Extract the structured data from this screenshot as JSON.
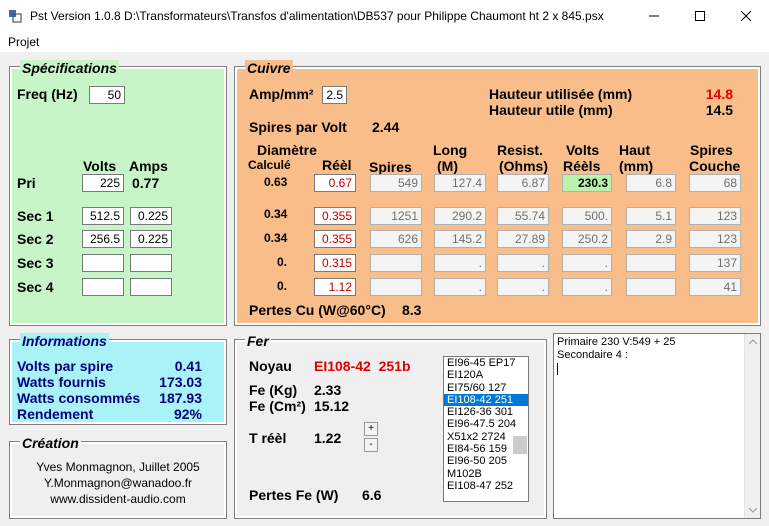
{
  "window": {
    "title": "Pst Version 1.0.8   D:\\Transformateurs\\Transfos d'alimentation\\DB537 pour Philippe Chaumont  ht 2 x 845.psx",
    "menu": [
      "Projet"
    ]
  },
  "specs": {
    "title": "Spécifications",
    "freq_label": "Freq (Hz)",
    "freq_value": "50",
    "volts_header": "Volts",
    "amps_header": "Amps",
    "rows": [
      {
        "label": "Pri",
        "volts": "225",
        "amps": "0.77"
      },
      {
        "label": "Sec 1",
        "volts": "512.5",
        "amps": "0.225"
      },
      {
        "label": "Sec 2",
        "volts": "256.5",
        "amps": "0.225"
      },
      {
        "label": "Sec 3",
        "volts": "",
        "amps": ""
      },
      {
        "label": "Sec 4",
        "volts": "",
        "amps": ""
      }
    ]
  },
  "cuivre": {
    "title": "Cuivre",
    "amp_label": "Amp/mm²",
    "amp_value": "2.5",
    "hauteur_utilisee_label": "Hauteur utilisée (mm)",
    "hauteur_utilisee_value": "14.8",
    "hauteur_utile_label": "Hauteur utile (mm)",
    "hauteur_utile_value": "14.5",
    "spires_volt_label": "Spires par Volt",
    "spires_volt_value": "2.44",
    "headers": {
      "diametre": "Diamètre",
      "calcule": "Calculé",
      "reel": "Réèl",
      "spires": "Spires",
      "long": "Long",
      "long_unit": "(M)",
      "resist": "Resist.",
      "resist_unit": "(Ohms)",
      "volts": "Volts",
      "volts_sub": "Réèls",
      "haut": "Haut",
      "haut_unit": "(mm)",
      "spires_couche": "Spires",
      "spires_couche_sub": "Couche"
    },
    "rows": [
      {
        "calc": "0.63",
        "reel": "0.67",
        "spires": "549",
        "long": "127.4",
        "resist": "6.87",
        "volts": "230.3",
        "haut": "6.8",
        "couche": "68"
      },
      {
        "calc": "0.34",
        "reel": "0.355",
        "spires": "1251",
        "long": "290.2",
        "resist": "55.74",
        "volts": "500.",
        "haut": "5.1",
        "couche": "123"
      },
      {
        "calc": "0.34",
        "reel": "0.355",
        "spires": "626",
        "long": "145.2",
        "resist": "27.89",
        "volts": "250.2",
        "haut": "2.9",
        "couche": "123"
      },
      {
        "calc": "0.",
        "reel": "0.315",
        "spires": "",
        "long": ".",
        "resist": ".",
        "volts": ".",
        "haut": "",
        "couche": "137"
      },
      {
        "calc": "0.",
        "reel": "1.12",
        "spires": "",
        "long": ".",
        "resist": ".",
        "volts": ".",
        "haut": "",
        "couche": "41"
      }
    ],
    "pertes_label": "Pertes Cu (W@60°C)",
    "pertes_value": "8.3"
  },
  "info": {
    "title": "Informations",
    "rows": [
      {
        "label": "Volts par spire",
        "value": "0.41"
      },
      {
        "label": "Watts fournis",
        "value": "173.03"
      },
      {
        "label": "Watts consommés",
        "value": "187.93"
      },
      {
        "label": "Rendement",
        "value": "92%"
      }
    ]
  },
  "creation": {
    "title": "Création",
    "author": "Yves Monmagnon, Juillet 2005",
    "email": "Y.Monmagnon@wanadoo.fr",
    "website": "www.dissident-audio.com"
  },
  "fer": {
    "title": "Fer",
    "noyau_label": "Noyau",
    "noyau_value": "EI108-42  251b",
    "fe_kg_label": "Fe (Kg)",
    "fe_kg_value": "2.33",
    "fe_cm2_label": "Fe (Cm²)",
    "fe_cm2_value": "15.12",
    "t_reel_label": "T réèl",
    "t_reel_value": "1.22",
    "spin_up": "+",
    "spin_down": "-",
    "pertes_label": "Pertes Fe (W)",
    "pertes_value": "6.6",
    "cores": [
      "EI96-45  EP17",
      "EI120A",
      "EI75/60  127",
      "EI108-42  251",
      "EI126-36  301",
      "EI96-47.5  204",
      "X51x2 2724",
      "EI84-56  159",
      "EI96-50  205",
      "M102B",
      "EI108-47 252"
    ],
    "selected_core": 3
  },
  "notes": {
    "line1": "Primaire 230 V:549 + 25",
    "line2": "Secondaire 4 :"
  },
  "colors": {
    "specs_bg": "#c8f5c8",
    "cuivre_bg": "#f9bd8a",
    "info_bg": "#a9f2f6",
    "creation_bg": "#efefef",
    "fer_bg": "#efefef",
    "red": "#e00000",
    "blue": "#000080"
  }
}
